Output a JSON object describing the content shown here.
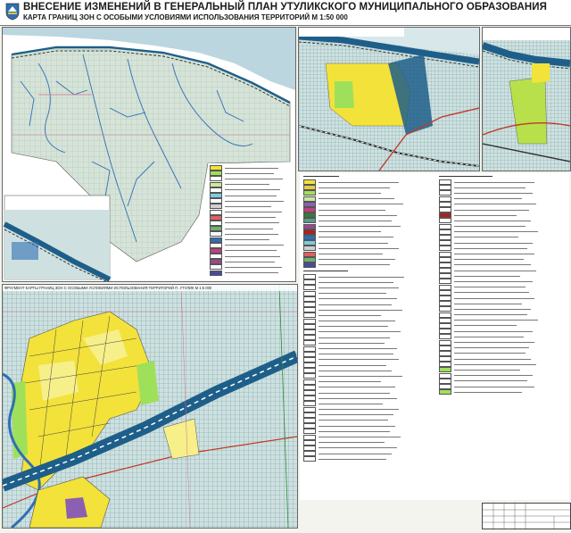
{
  "header": {
    "title": "ВНЕСЕНИЕ ИЗМЕНЕНИЙ В ГЕНЕРАЛЬНЫЙ ПЛАН УТУЛИКСКОГО МУНИЦИПАЛЬНОГО ОБРАЗОВАНИЯ",
    "subtitle": "КАРТА ГРАНИЦ ЗОН С ОСОБЫМИ УСЛОВИЯМИ ИСПОЛЬЗОВАНИЯ ТЕРРИТОРИЙ   М 1:50 000"
  },
  "insets": {
    "bottom_main": "ФРАГМЕНТ КАРТЫ ГРАНИЦ ЗОН С ОСОБЫМИ УСЛОВИЯМИ ИСПОЛЬЗОВАНИЯ ТЕРРИТОРИЙ П. УТУЛИК  М 1:5 000"
  },
  "colors": {
    "residential": "#f2e23a",
    "residential_light": "#f7ef8a",
    "green_zone": "#9fe05a",
    "water": "#2f6fb3",
    "protection_zone": "#1e5f8a",
    "railway": "#333333",
    "road": "#c0392b",
    "forest_bg": "#d6e3d7",
    "hatch": "#6aa0a0"
  },
  "legend": {
    "swatches": [
      "#f2e23a",
      "#e8c84a",
      "#9fe05a",
      "#c9e8a0",
      "#8d5fb0",
      "#c04080",
      "#3a7a3a",
      "#5a9a8a",
      "#9a4a8a",
      "#b02020",
      "#2f6fb3",
      "#7acbe0",
      "#d0d0d0",
      "#e06060",
      "#70b070",
      "#4a4a9a"
    ]
  },
  "icons": {
    "emblem": "coat-of-arms-icon"
  }
}
